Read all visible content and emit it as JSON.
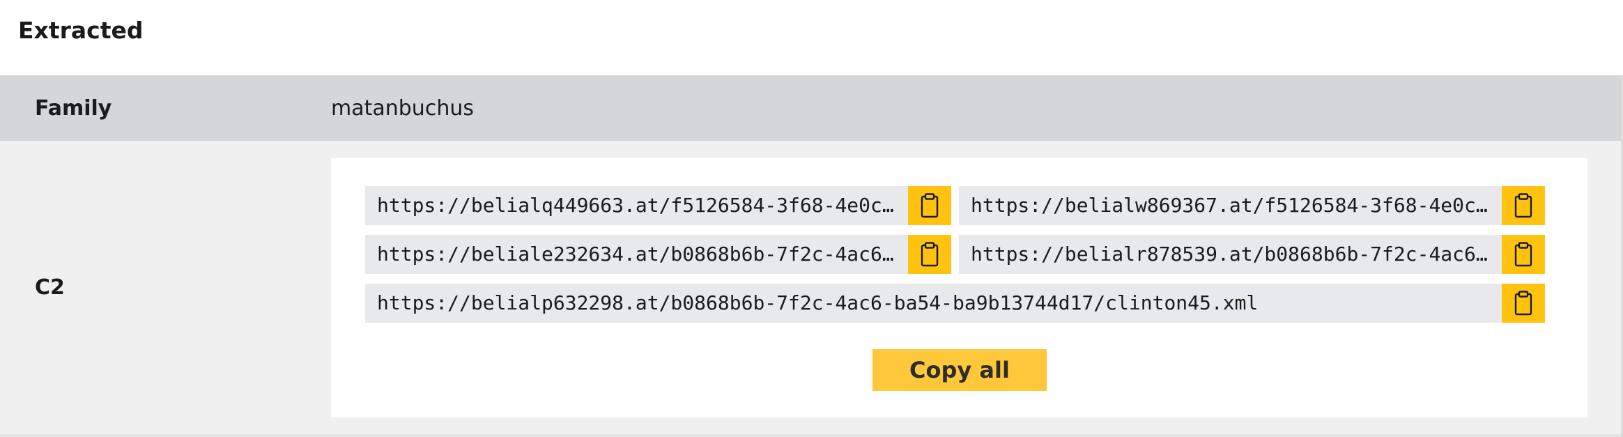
{
  "header": {
    "title": "Extracted"
  },
  "family": {
    "label": "Family",
    "value": "matanbuchus"
  },
  "c2": {
    "label": "C2",
    "urls": [
      "https://belialq449663.at/f5126584-3f68-4e0c-…",
      "https://belialw869367.at/f5126584-3f68-4e0c-…",
      "https://beliale232634.at/b0868b6b-7f2c-4ac6-…",
      "https://belialr878539.at/b0868b6b-7f2c-4ac6-…",
      "https://belialp632298.at/b0868b6b-7f2c-4ac6-ba54-ba9b13744d17/clinton45.xml"
    ],
    "copy_icon": "clipboard-icon",
    "copy_all_label": "Copy all"
  },
  "colors": {
    "accent": "#ffc20e",
    "copy_all_bg": "#ffc83a",
    "row_family_bg": "#d5d6d8",
    "url_bg": "#e8e9eb"
  }
}
